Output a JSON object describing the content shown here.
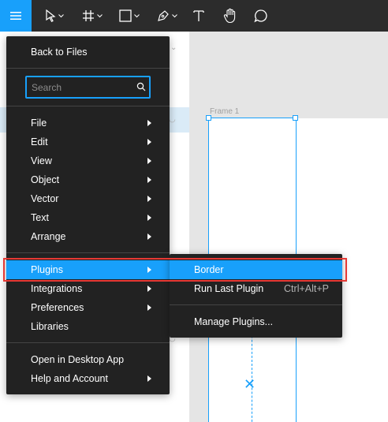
{
  "colors": {
    "accent": "#18a0fb",
    "menu_bg": "#222222",
    "toolbar_bg": "#2c2c2c",
    "highlight": "#e53935"
  },
  "toolbar": {
    "tools": [
      {
        "icon": "hamburger-menu-icon"
      },
      {
        "icon": "move-pointer-icon"
      },
      {
        "icon": "frame-hash-icon"
      },
      {
        "icon": "rectangle-shape-icon"
      },
      {
        "icon": "pen-icon"
      },
      {
        "icon": "text-icon",
        "label": "T"
      },
      {
        "icon": "hand-icon"
      },
      {
        "icon": "comment-icon"
      }
    ]
  },
  "main_menu": {
    "back": "Back to Files",
    "search_placeholder": "Search",
    "items": [
      {
        "label": "File",
        "submenu": true
      },
      {
        "label": "Edit",
        "submenu": true
      },
      {
        "label": "View",
        "submenu": true
      },
      {
        "label": "Object",
        "submenu": true
      },
      {
        "label": "Vector",
        "submenu": true
      },
      {
        "label": "Text",
        "submenu": true
      },
      {
        "label": "Arrange",
        "submenu": true
      }
    ],
    "items2": [
      {
        "label": "Plugins",
        "submenu": true,
        "active": true
      },
      {
        "label": "Integrations",
        "submenu": true
      },
      {
        "label": "Preferences",
        "submenu": true
      },
      {
        "label": "Libraries",
        "submenu": false
      }
    ],
    "items3": [
      {
        "label": "Open in Desktop App",
        "submenu": false
      },
      {
        "label": "Help and Account",
        "submenu": true
      }
    ]
  },
  "plugins_menu": {
    "border": "Border",
    "run_last": "Run Last Plugin",
    "run_last_shortcut": "Ctrl+Alt+P",
    "manage": "Manage Plugins..."
  },
  "canvas": {
    "frame_label": "Frame 1"
  }
}
